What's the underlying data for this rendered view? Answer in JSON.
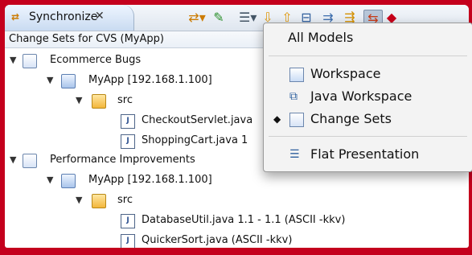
{
  "view": {
    "tab_title": "Synchronize",
    "tab_close": "✕",
    "subtitle": "Change Sets for CVS (MyApp)"
  },
  "toolbar": {
    "items": [
      {
        "icon": "sync-dropdown-icon",
        "glyph": "⇄▾"
      },
      {
        "icon": "pin-icon",
        "glyph": "✎"
      },
      {
        "icon": "layout-dropdown-icon",
        "glyph": "☰▾"
      },
      {
        "icon": "next-arrow-icon",
        "glyph": "⇩"
      },
      {
        "icon": "prev-arrow-icon",
        "glyph": "⇧"
      },
      {
        "icon": "collapse-all-icon",
        "glyph": "⊟"
      },
      {
        "icon": "incoming-mode-icon",
        "glyph": "⇉"
      },
      {
        "icon": "outgoing-mode-icon",
        "glyph": "⇶"
      },
      {
        "icon": "both-mode-icon",
        "glyph": "⇆"
      },
      {
        "icon": "conflicts-mode-icon",
        "glyph": "◆"
      }
    ]
  },
  "tree": [
    {
      "text": "Ecommerce Bugs",
      "kind": "changeset",
      "level": 0
    },
    {
      "text": "MyApp  [192.168.1.100]",
      "kind": "project",
      "level": 1
    },
    {
      "text": "src",
      "kind": "folder",
      "level": 2
    },
    {
      "text": "CheckoutServlet.java",
      "kind": "file",
      "level": 3
    },
    {
      "text": "ShoppingCart.java  1",
      "kind": "file",
      "level": 3
    },
    {
      "text": "Performance Improvements",
      "kind": "changeset",
      "level": 0
    },
    {
      "text": "MyApp  [192.168.1.100]",
      "kind": "project",
      "level": 1
    },
    {
      "text": "src",
      "kind": "folder",
      "level": 2
    },
    {
      "text": "DatabaseUtil.java  1.1 - 1.1  (ASCII -kkv)",
      "kind": "file",
      "level": 3
    },
    {
      "text": "QuickerSort.java   (ASCII -kkv)",
      "kind": "file",
      "level": 3
    }
  ],
  "menu": {
    "items": [
      {
        "label": "All Models",
        "icon": "",
        "checked": false
      },
      {
        "label": "Workspace",
        "icon": "workspace-icon",
        "checked": false
      },
      {
        "label": "Java Workspace",
        "icon": "java-workspace-icon",
        "checked": false
      },
      {
        "label": "Change Sets",
        "icon": "change-sets-icon",
        "checked": true
      },
      {
        "label": "Flat Presentation",
        "icon": "flat-list-icon",
        "checked": false
      }
    ]
  }
}
